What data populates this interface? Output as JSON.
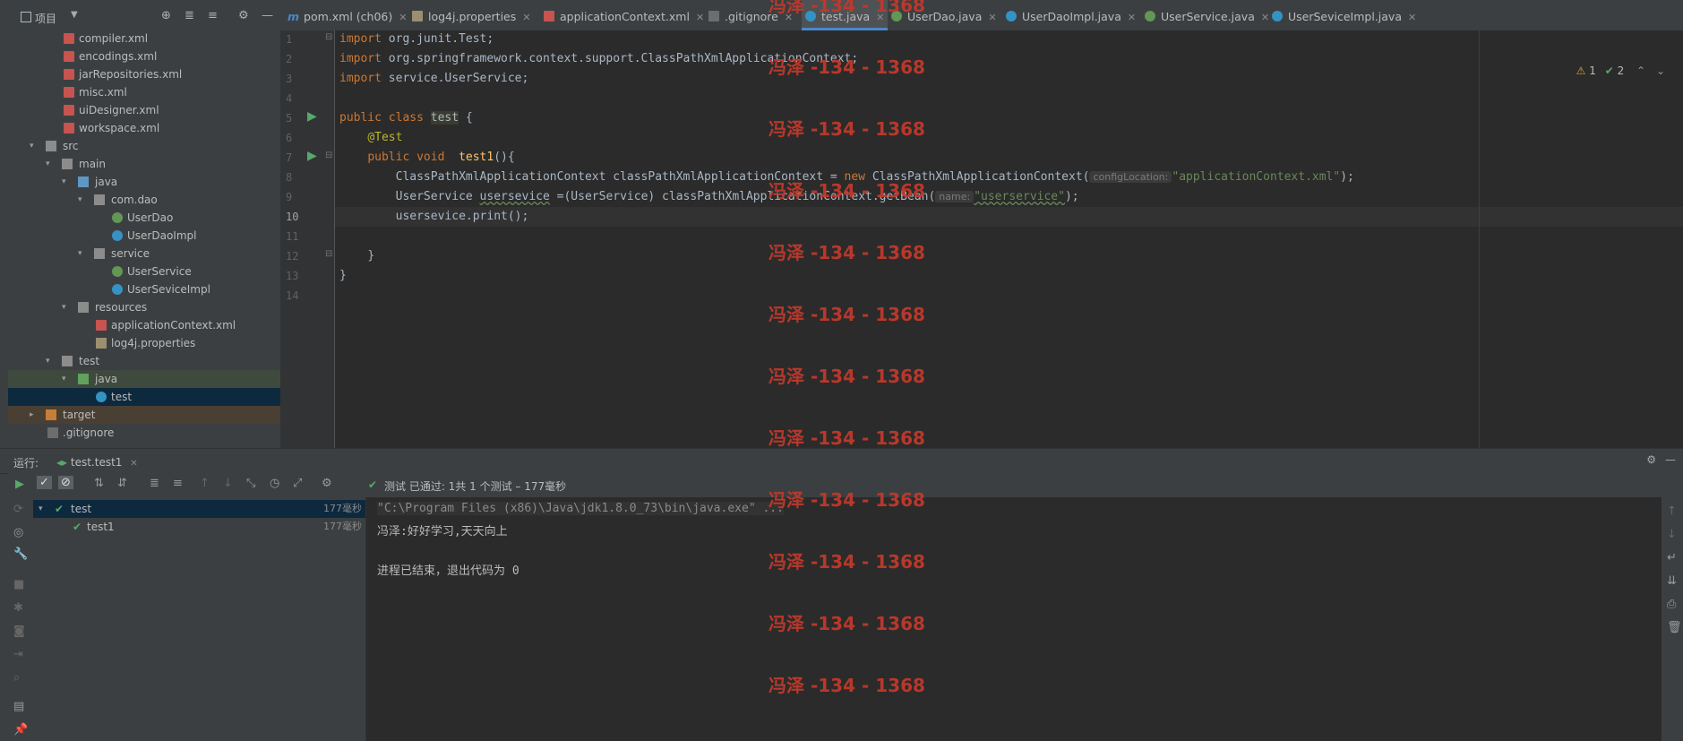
{
  "project_panel": {
    "title": "项目",
    "tree": [
      {
        "label": "compiler.xml",
        "icon": "xml-file-icon",
        "depth": 3
      },
      {
        "label": "encodings.xml",
        "icon": "xml-file-icon",
        "depth": 3
      },
      {
        "label": "jarRepositories.xml",
        "icon": "xml-file-icon",
        "depth": 3
      },
      {
        "label": "misc.xml",
        "icon": "xml-file-icon",
        "depth": 3
      },
      {
        "label": "uiDesigner.xml",
        "icon": "xml-file-icon",
        "depth": 3
      },
      {
        "label": "workspace.xml",
        "icon": "xml-file-icon",
        "depth": 3
      },
      {
        "label": "src",
        "icon": "folder-icon",
        "depth": 1,
        "expanded": true
      },
      {
        "label": "main",
        "icon": "folder-icon",
        "depth": 2,
        "expanded": true
      },
      {
        "label": "java",
        "icon": "source-folder-icon",
        "depth": 3,
        "expanded": true
      },
      {
        "label": "com.dao",
        "icon": "package-icon",
        "depth": 4,
        "expanded": true
      },
      {
        "label": "UserDao",
        "icon": "interface-icon",
        "depth": 5
      },
      {
        "label": "UserDaoImpl",
        "icon": "class-icon",
        "depth": 5
      },
      {
        "label": "service",
        "icon": "package-icon",
        "depth": 4,
        "expanded": true
      },
      {
        "label": "UserService",
        "icon": "interface-icon",
        "depth": 5
      },
      {
        "label": "UserSeviceImpl",
        "icon": "class-icon",
        "depth": 5
      },
      {
        "label": "resources",
        "icon": "resources-folder-icon",
        "depth": 3,
        "expanded": true
      },
      {
        "label": "applicationContext.xml",
        "icon": "xml-file-icon",
        "depth": 4
      },
      {
        "label": "log4j.properties",
        "icon": "properties-file-icon",
        "depth": 4
      },
      {
        "label": "test",
        "icon": "folder-icon",
        "depth": 2,
        "expanded": true
      },
      {
        "label": "java",
        "icon": "test-folder-icon",
        "depth": 3,
        "expanded": true
      },
      {
        "label": "test",
        "icon": "test-class-icon",
        "depth": 4,
        "selected": true
      },
      {
        "label": "target",
        "icon": "excluded-folder-icon",
        "depth": 1,
        "expanded": false
      },
      {
        "label": ".gitignore",
        "icon": "gitignore-file-icon",
        "depth": 1
      }
    ]
  },
  "tabs": [
    {
      "label": "pom.xml (ch06)",
      "icon": "maven-icon"
    },
    {
      "label": "log4j.properties",
      "icon": "properties-file-icon"
    },
    {
      "label": "applicationContext.xml",
      "icon": "xml-file-icon"
    },
    {
      "label": ".gitignore",
      "icon": "gitignore-file-icon"
    },
    {
      "label": "test.java",
      "icon": "test-class-icon",
      "active": true
    },
    {
      "label": "UserDao.java",
      "icon": "interface-icon"
    },
    {
      "label": "UserDaoImpl.java",
      "icon": "class-icon"
    },
    {
      "label": "UserService.java",
      "icon": "interface-icon"
    },
    {
      "label": "UserSeviceImpl.java",
      "icon": "class-icon"
    }
  ],
  "editor": {
    "line_numbers": [
      "1",
      "2",
      "3",
      "4",
      "5",
      "6",
      "7",
      "8",
      "9",
      "10",
      "11",
      "12",
      "13",
      "14"
    ],
    "inspections": {
      "warnings": "1",
      "ok": "2"
    },
    "lines": {
      "l1": {
        "kw": "import",
        "rest": " org.junit.Test;"
      },
      "l2": {
        "kw": "import",
        "rest": " org.springframework.context.support.ClassPathXmlApplicationContext;"
      },
      "l3": {
        "kw": "import",
        "rest": " service.UserService;"
      },
      "l5": {
        "kw": "public class",
        "name": "test",
        "rest": " {"
      },
      "l6": {
        "annotation": "@Test"
      },
      "l7": {
        "kw": "public void",
        "method": "test1",
        "rest": "(){"
      },
      "l8": {
        "pre": "ClassPathXmlApplicationContext classPathXmlApplicationContext = ",
        "kw": "new",
        "mid": " ClassPathXmlApplicationContext(",
        "hint": "configLocation:",
        "str": "\"applicationContext.xml\"",
        "post": ");"
      },
      "l9": {
        "pre": "UserService ",
        "var": "usersevice",
        "mid": " =(UserService) classPathXmlApplicationContext.getBean(",
        "hint": "name:",
        "str": "\"userservice\"",
        "post": ");"
      },
      "l10": {
        "text": "usersevice.print();"
      },
      "l12": {
        "text": "}"
      },
      "l13": {
        "text": "}"
      }
    }
  },
  "watermark": "冯泽 -134 - 1368",
  "run_panel": {
    "label": "运行:",
    "tab": "test.test1",
    "status": "测试 已通过: 1共 1 个测试 – 177毫秒",
    "status_check": "✔",
    "tree": [
      {
        "label": "test",
        "time": "177毫秒"
      },
      {
        "label": "test1",
        "time": "177毫秒"
      }
    ],
    "console": [
      "\"C:\\Program Files (x86)\\Java\\jdk1.8.0_73\\bin\\java.exe\" ...",
      "冯泽:好好学习,天天向上",
      "",
      "进程已结束，退出代码为 0"
    ]
  },
  "colors": {
    "background": "#2b2b2b",
    "panel": "#3c3f41",
    "keyword": "#cc7832",
    "string": "#6a8759",
    "annotation": "#bbb529",
    "method": "#ffc66d",
    "watermark": "#c0392b",
    "pass_green": "#59a869"
  }
}
